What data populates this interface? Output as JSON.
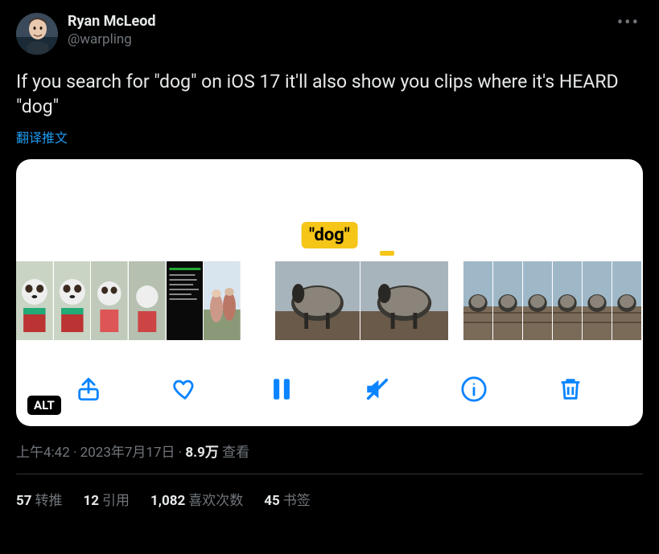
{
  "user": {
    "display_name": "Ryan McLeod",
    "handle": "@warpling"
  },
  "tweet_text": "If you search for \"dog\" on iOS 17 it'll also show you clips where it's HEARD \"dog\"",
  "translate_label": "翻译推文",
  "media": {
    "caption_pill": "\"dog\"",
    "alt_badge": "ALT"
  },
  "meta": {
    "time": "上午4:42",
    "date": "2023年7月17日",
    "views_count": "8.9万",
    "views_label": "查看",
    "separator": " · "
  },
  "stats": {
    "retweets": {
      "count": "57",
      "label": "转推"
    },
    "quotes": {
      "count": "12",
      "label": "引用"
    },
    "likes": {
      "count": "1,082",
      "label": "喜欢次数"
    },
    "bookmarks": {
      "count": "45",
      "label": "书签"
    }
  }
}
